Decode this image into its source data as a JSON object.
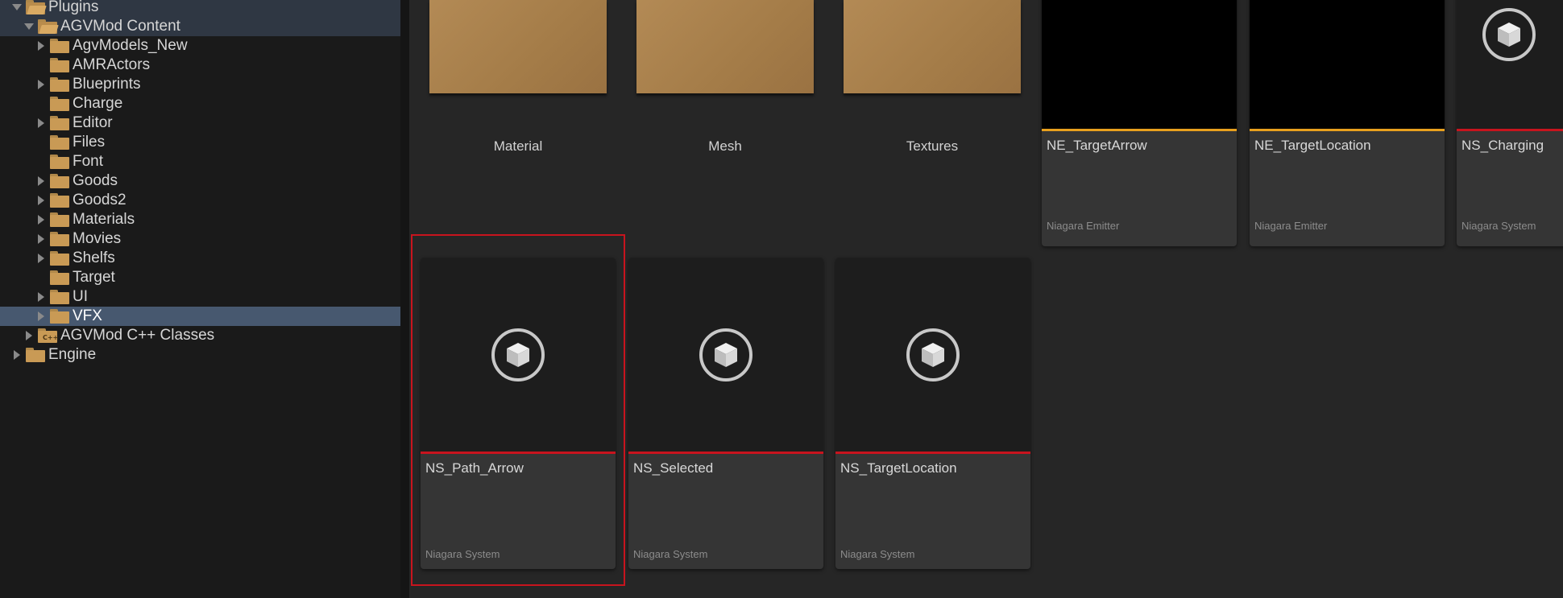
{
  "tree": {
    "items": [
      {
        "label": "Plugins",
        "expanded": true,
        "icon": "folder-open-icon"
      },
      {
        "label": "AGVMod Content",
        "expanded": true,
        "icon": "folder-open-icon"
      },
      {
        "label": "AgvModels_New",
        "expandable": true,
        "icon": "folder-icon"
      },
      {
        "label": "AMRActors",
        "expandable": false,
        "icon": "folder-icon"
      },
      {
        "label": "Blueprints",
        "expandable": true,
        "icon": "folder-icon"
      },
      {
        "label": "Charge",
        "expandable": false,
        "icon": "folder-icon"
      },
      {
        "label": "Editor",
        "expandable": true,
        "icon": "folder-icon"
      },
      {
        "label": "Files",
        "expandable": false,
        "icon": "folder-icon"
      },
      {
        "label": "Font",
        "expandable": false,
        "icon": "folder-icon"
      },
      {
        "label": "Goods",
        "expandable": true,
        "icon": "folder-icon"
      },
      {
        "label": "Goods2",
        "expandable": true,
        "icon": "folder-icon"
      },
      {
        "label": "Materials",
        "expandable": true,
        "icon": "folder-icon"
      },
      {
        "label": "Movies",
        "expandable": true,
        "icon": "folder-icon"
      },
      {
        "label": "Shelfs",
        "expandable": true,
        "icon": "folder-icon"
      },
      {
        "label": "Target",
        "expandable": false,
        "icon": "folder-icon"
      },
      {
        "label": "UI",
        "expandable": true,
        "icon": "folder-icon"
      },
      {
        "label": "VFX",
        "expandable": true,
        "selected": true,
        "icon": "folder-icon"
      },
      {
        "label": "AGVMod C++ Classes",
        "expandable": true,
        "icon": "cpp-folder-icon"
      },
      {
        "label": "Engine",
        "expandable": true,
        "icon": "folder-icon"
      }
    ]
  },
  "folders": [
    {
      "label": "Material"
    },
    {
      "label": "Mesh"
    },
    {
      "label": "Textures"
    }
  ],
  "assets": [
    {
      "name": "NE_TargetArrow",
      "type": "Niagara Emitter",
      "accent": "#e8a01e"
    },
    {
      "name": "NE_TargetLocation",
      "type": "Niagara Emitter",
      "accent": "#e8a01e"
    },
    {
      "name": "NS_Charging",
      "type": "Niagara System",
      "accent": "#c8141e"
    },
    {
      "name": "NS_Path_Arrow",
      "type": "Niagara System",
      "accent": "#c8141e",
      "selected": true
    },
    {
      "name": "NS_Selected",
      "type": "Niagara System",
      "accent": "#c8141e"
    },
    {
      "name": "NS_TargetLocation",
      "type": "Niagara System",
      "accent": "#c8141e"
    }
  ],
  "colors": {
    "folder": "#c99a55",
    "emitter_accent": "#e8a01e",
    "system_accent": "#c8141e",
    "selection_row": "#47586f"
  }
}
